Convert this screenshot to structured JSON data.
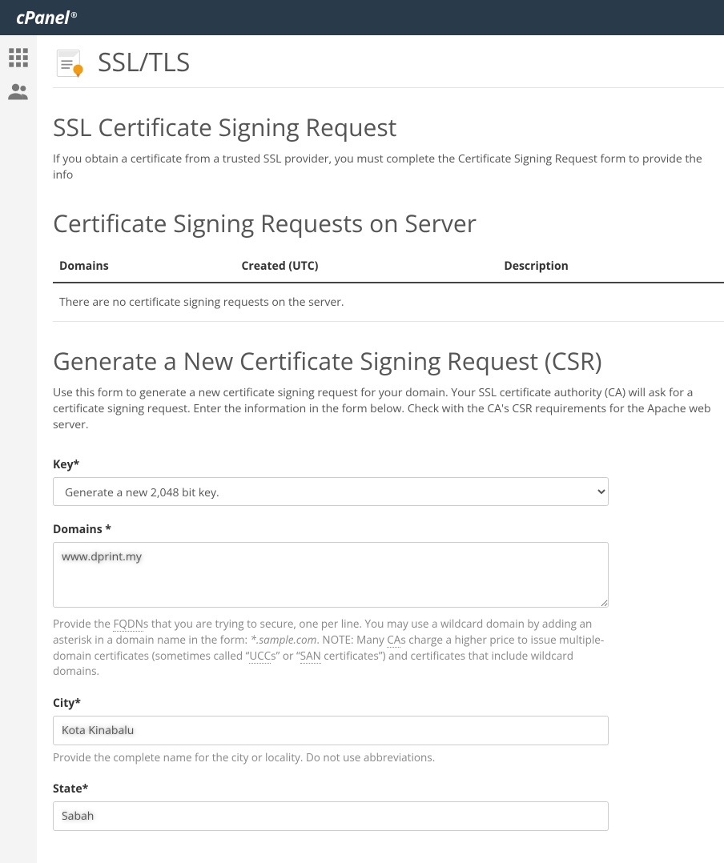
{
  "brand": "cPanel",
  "page": {
    "title": "SSL/TLS",
    "section_title": "SSL Certificate Signing Request",
    "section_desc": "If you obtain a certificate from a trusted SSL provider, you must complete the Certificate Signing Request form to provide the info"
  },
  "csr_list": {
    "heading": "Certificate Signing Requests on Server",
    "columns": {
      "domains": "Domains",
      "created": "Created (UTC)",
      "description": "Description"
    },
    "empty": "There are no certificate signing requests on the server."
  },
  "generate": {
    "heading": "Generate a New Certificate Signing Request (CSR)",
    "desc": "Use this form to generate a new certificate signing request for your domain. Your SSL certificate authority (CA) will ask for a certificate signing request. Enter the information in the form below. Check with the CA's CSR requirements for the Apache web server."
  },
  "form": {
    "key": {
      "label": "Key*",
      "value": "Generate a new 2,048 bit key."
    },
    "domains": {
      "label": "Domains *",
      "value": "www.dprint.my",
      "help_pre": "Provide the ",
      "fqdn": "FQDN",
      "help_mid1": "s that you are trying to secure, one per line. You may use a wildcard domain by adding an asterisk in a domain name in the form: ",
      "example": "*.sample.com",
      "help_mid2": ". NOTE: Many ",
      "ca": "CA",
      "help_mid3": "s charge a higher price to issue multiple-domain certificates (sometimes called “",
      "ucc": "UCC",
      "help_mid4": "s” or “",
      "san": "SAN",
      "help_end": " certificates”) and certificates that include wildcard domains."
    },
    "city": {
      "label": "City*",
      "value": "Kota Kinabalu",
      "help": "Provide the complete name for the city or locality. Do not use abbreviations."
    },
    "state": {
      "label": "State*",
      "value": "Sabah"
    }
  }
}
